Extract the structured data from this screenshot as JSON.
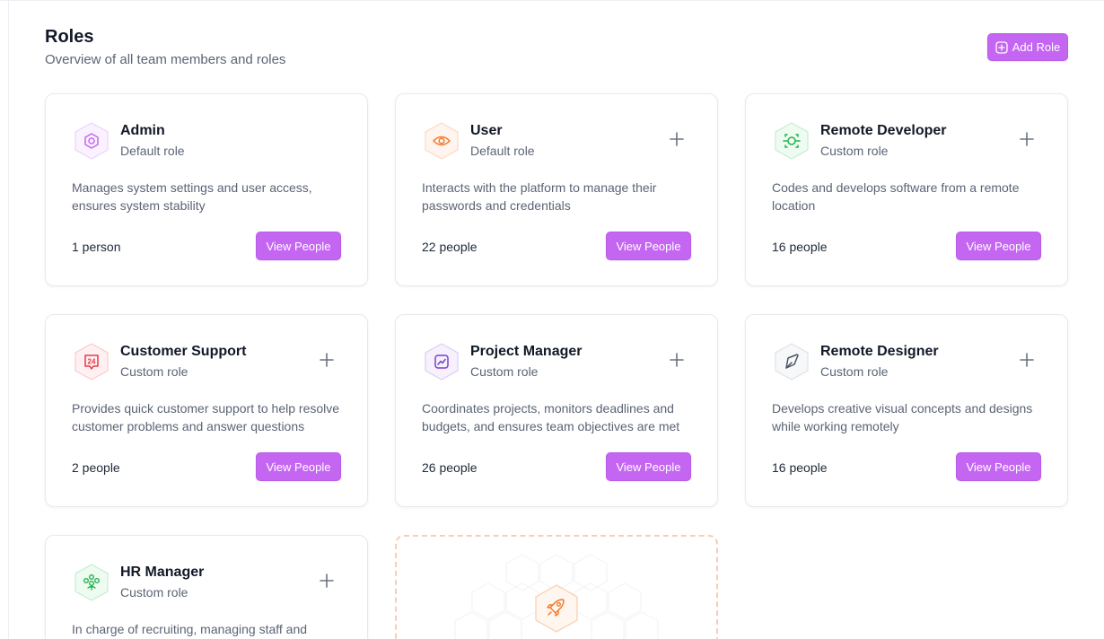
{
  "header": {
    "title": "Roles",
    "subtitle": "Overview of all team members and roles",
    "add_role_label": "Add Role"
  },
  "colors": {
    "accent": "#c466f2",
    "text_primary": "#111827",
    "text_secondary": "#5b6475"
  },
  "roles": [
    {
      "name": "Admin",
      "type": "Default role",
      "description": "Manages system settings and user access, ensures system stability",
      "count": "1 person",
      "icon": "settings-hex-icon",
      "icon_color": "#c466f2",
      "view_label": "View People",
      "has_add": false
    },
    {
      "name": "User",
      "type": "Default role",
      "description": "Interacts with the platform to manage their passwords and credentials",
      "count": "22 people",
      "icon": "eye-icon",
      "icon_color": "#f07a2c",
      "view_label": "View People",
      "has_add": true
    },
    {
      "name": "Remote Developer",
      "type": "Custom role",
      "description": "Codes and develops software from a remote location",
      "count": "16 people",
      "icon": "developer-icon",
      "icon_color": "#22b24c",
      "view_label": "View People",
      "has_add": true
    },
    {
      "name": "Customer Support",
      "type": "Custom role",
      "description": "Provides quick customer support to help resolve customer problems and answer questions",
      "count": "2 people",
      "icon": "support-24-icon",
      "icon_color": "#e5384b",
      "view_label": "View People",
      "has_add": true
    },
    {
      "name": "Project Manager",
      "type": "Custom role",
      "description": "Coordinates projects, monitors deadlines and budgets, and ensures team objectives are met",
      "count": "26 people",
      "icon": "trend-chart-icon",
      "icon_color": "#7b3fc9",
      "view_label": "View People",
      "has_add": true
    },
    {
      "name": "Remote Designer",
      "type": "Custom role",
      "description": "Develops creative visual concepts and designs while working remotely",
      "count": "16 people",
      "icon": "pen-tool-icon",
      "icon_color": "#4b5563",
      "view_label": "View People",
      "has_add": true
    },
    {
      "name": "HR Manager",
      "type": "Custom role",
      "description": "In charge of recruiting, managing staff and",
      "count": "",
      "icon": "team-network-icon",
      "icon_color": "#22b24c",
      "view_label": "",
      "has_add": true
    }
  ],
  "add_card": {
    "icon": "rocket-icon",
    "icon_color": "#f07a2c"
  }
}
